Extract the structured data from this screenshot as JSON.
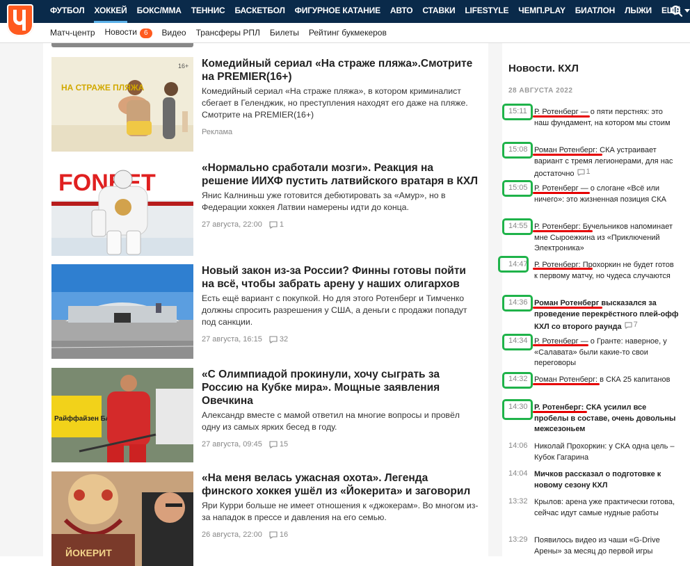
{
  "nav": {
    "items": [
      "ФУТБОЛ",
      "ХОККЕЙ",
      "БОКС/ММА",
      "ТЕННИС",
      "БАСКЕТБОЛ",
      "ФИГУРНОЕ КАТАНИЕ",
      "АВТО",
      "СТАВКИ",
      "LIFESTYLE",
      "ЧЕМП.PLAY",
      "БИАТЛОН",
      "ЛЫЖИ",
      "ЕЩЁ"
    ],
    "active": "ХОККЕЙ"
  },
  "subnav": {
    "items": [
      "Матч-центр",
      "Новости",
      "Видео",
      "Трансферы РПЛ",
      "Билеты",
      "Рейтинг букмекеров"
    ],
    "news_badge": "6"
  },
  "articles": [
    {
      "title": "Комедийный сериал «На страже пляжа».Смотрите на PREMIER(16+)",
      "text": "Комедийный сериал «На страже пляжа», в котором криминалист сбегает в Геленджик, но преступления находят его даже на пляже. Смотрите на PREMIER(16+)",
      "meta": "Реклама",
      "comments": ""
    },
    {
      "title": "«Нормально сработали мозги». Реакция на решение ИИХФ пустить латвийского вратаря в КХЛ",
      "text": "Янис Калниньш уже готовится дебютировать за «Амур», но в Федерации хоккея Латвии намерены идти до конца.",
      "meta": "27 августа, 22:00",
      "comments": "1"
    },
    {
      "title": "Новый закон из-за России? Финны готовы пойти на всё, чтобы забрать арену у наших олигархов",
      "text": "Есть ещё вариант с покупкой. Но для этого Ротенберг и Тимченко должны спросить разрешения у США, а деньги с продажи попадут под санкции.",
      "meta": "27 августа, 16:15",
      "comments": "32"
    },
    {
      "title": "«С Олимпиадой прокинули, хочу сыграть за Россию на Кубке мира». Мощные заявления Овечкина",
      "text": "Александр вместе с мамой ответил на многие вопросы и провёл одну из самых ярких бесед в году.",
      "meta": "27 августа, 09:45",
      "comments": "15"
    },
    {
      "title": "«На меня велась ужасная охота». Легенда финского хоккея ушёл из «Йокерита» и заговорил",
      "text": "Яри Курри больше не имеет отношения к «джокерам». Во многом из-за нападок в прессе и давления на его семью.",
      "meta": "26 августа, 22:00",
      "comments": "16"
    }
  ],
  "thumbs": {
    "beach_text": "НА СТРАЖЕ ПЛЯЖА",
    "beach_age": "16+",
    "fonbet": "FONBET",
    "raiffeisen": "Райффайзен БАНК",
    "jokerit": "ЙОКЕРИТ"
  },
  "sidebar": {
    "title": "Новости. КХЛ",
    "date": "28 АВГУСТА 2022",
    "news": [
      {
        "time": "15:11",
        "text": "Р. Ротенберг — о пяти перстнях: это наш фундамент, на котором мы стоим",
        "bold": false,
        "comments": ""
      },
      {
        "time": "15:08",
        "text": "Роман Ротенберг: СКА устраивает вариант с тремя легионерами, для нас достаточно",
        "bold": false,
        "comments": "1"
      },
      {
        "time": "15:05",
        "text": "Р. Ротенберг — о слогане «Всё или ничего»: это жизненная позиция СКА",
        "bold": false,
        "comments": ""
      },
      {
        "time": "14:55",
        "text": "Р. Ротенберг: Бучельников напоминает мне Сыроежкина из «Приключений Электроника»",
        "bold": false,
        "comments": ""
      },
      {
        "time": "14:47",
        "text": "Р. Ротенберг: Прохоркин не будет готов к первому матчу, но чудеса случаются",
        "bold": false,
        "comments": ""
      },
      {
        "time": "14:36",
        "text": "Роман Ротенберг высказался за проведение перекрёстного плей-офф КХЛ со второго раунда",
        "bold": true,
        "comments": "7"
      },
      {
        "time": "14:34",
        "text": "Р. Ротенберг — о Гранте: наверное, у «Салавата» были какие-то свои переговоры",
        "bold": false,
        "comments": ""
      },
      {
        "time": "14:32",
        "text": "Роман Ротенберг: в СКА 25 капитанов",
        "bold": false,
        "comments": ""
      },
      {
        "time": "14:30",
        "text": "Р. Ротенберг: СКА усилил все пробелы в составе, очень довольны межсезоньем",
        "bold": true,
        "comments": ""
      },
      {
        "time": "14:06",
        "text": "Николай Прохоркин: у СКА одна цель – Кубок Гагарина",
        "bold": false,
        "comments": ""
      },
      {
        "time": "14:04",
        "text": "Мичков рассказал о подготовке к новому сезону КХЛ",
        "bold": true,
        "comments": ""
      },
      {
        "time": "13:32",
        "text": "Крылов: арена уже практически готова, сейчас идут самые нудные работы",
        "bold": false,
        "comments": ""
      },
      {
        "time": "13:29",
        "text": "Появилось видео из чаши «G-Drive Арены» за месяц до первой игры",
        "bold": false,
        "comments": ""
      }
    ]
  },
  "colors": {
    "nav_bg": "#0a2a4a",
    "accent": "#ff5a1f",
    "annotation_box": "#1fb34a",
    "annotation_underline": "#e60000"
  }
}
